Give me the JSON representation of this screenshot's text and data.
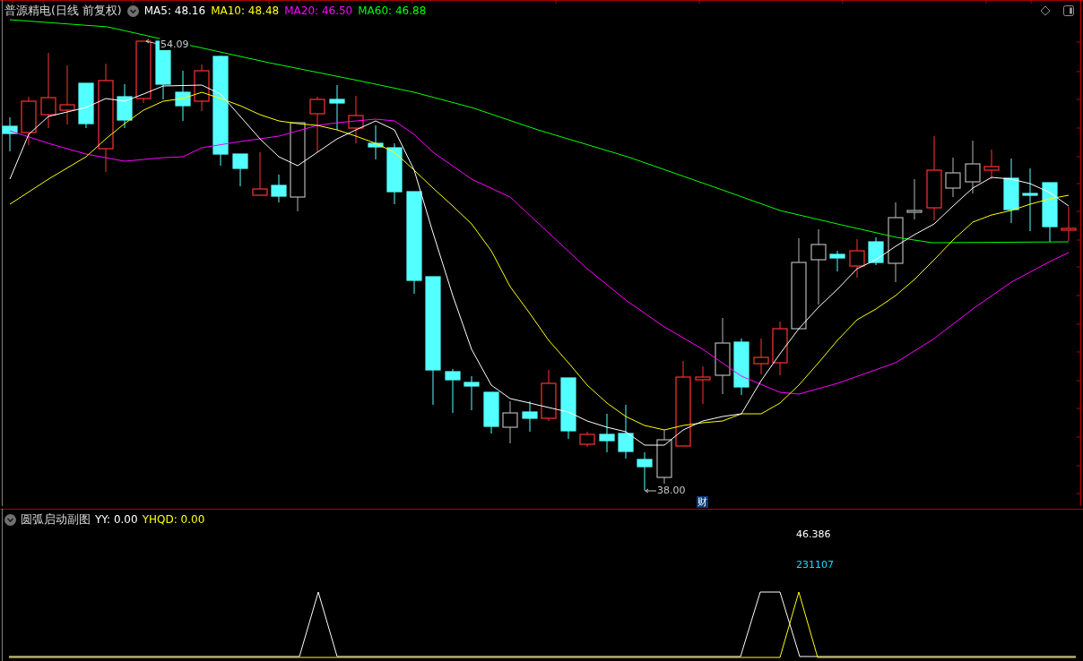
{
  "header": {
    "title": "普源精电(日线 前复权)",
    "indicators": [
      {
        "label": "MA5: 48.16",
        "color": "#ffffff"
      },
      {
        "label": "MA10: 48.48",
        "color": "#ffff00"
      },
      {
        "label": "MA20: 46.50",
        "color": "#ff00ff"
      },
      {
        "label": "MA60: 46.88",
        "color": "#00ff00"
      }
    ]
  },
  "price_chart": {
    "high_label": "54.09",
    "low_label": "38.00",
    "event_badge": "财"
  },
  "sub_chart": {
    "title": "圆弧启动副图",
    "indicators": [
      {
        "label": "YY: 0.00",
        "color": "#ffffff"
      },
      {
        "label": "YHQD: 0.00",
        "color": "#ffff00"
      }
    ],
    "readings": [
      {
        "text": "46.386",
        "color": "#ffffff"
      },
      {
        "text": "231107",
        "color": "#00e5ff"
      }
    ]
  }
}
